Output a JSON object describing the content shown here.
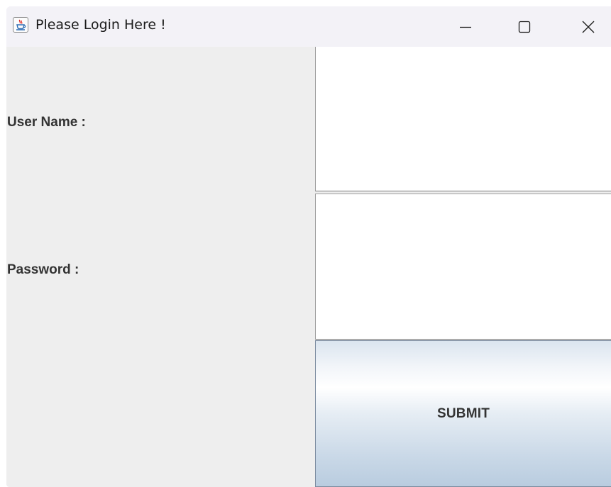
{
  "window": {
    "title": "Please Login Here !",
    "app_icon": "java-cup-icon",
    "controls": {
      "minimize_icon": "minimize-icon",
      "maximize_icon": "maximize-icon",
      "close_icon": "close-icon"
    }
  },
  "form": {
    "username_label": "User Name :",
    "username_value": "",
    "password_label": "Password :",
    "password_value": "",
    "submit_label": "SUBMIT"
  },
  "colors": {
    "panel_background": "#eeeeee",
    "titlebar_background": "#f3f2f7",
    "field_background": "#ffffff",
    "label_text": "#333333",
    "button_gradient_top": "#dbe5ef",
    "button_gradient_bottom": "#b9ccdf"
  }
}
